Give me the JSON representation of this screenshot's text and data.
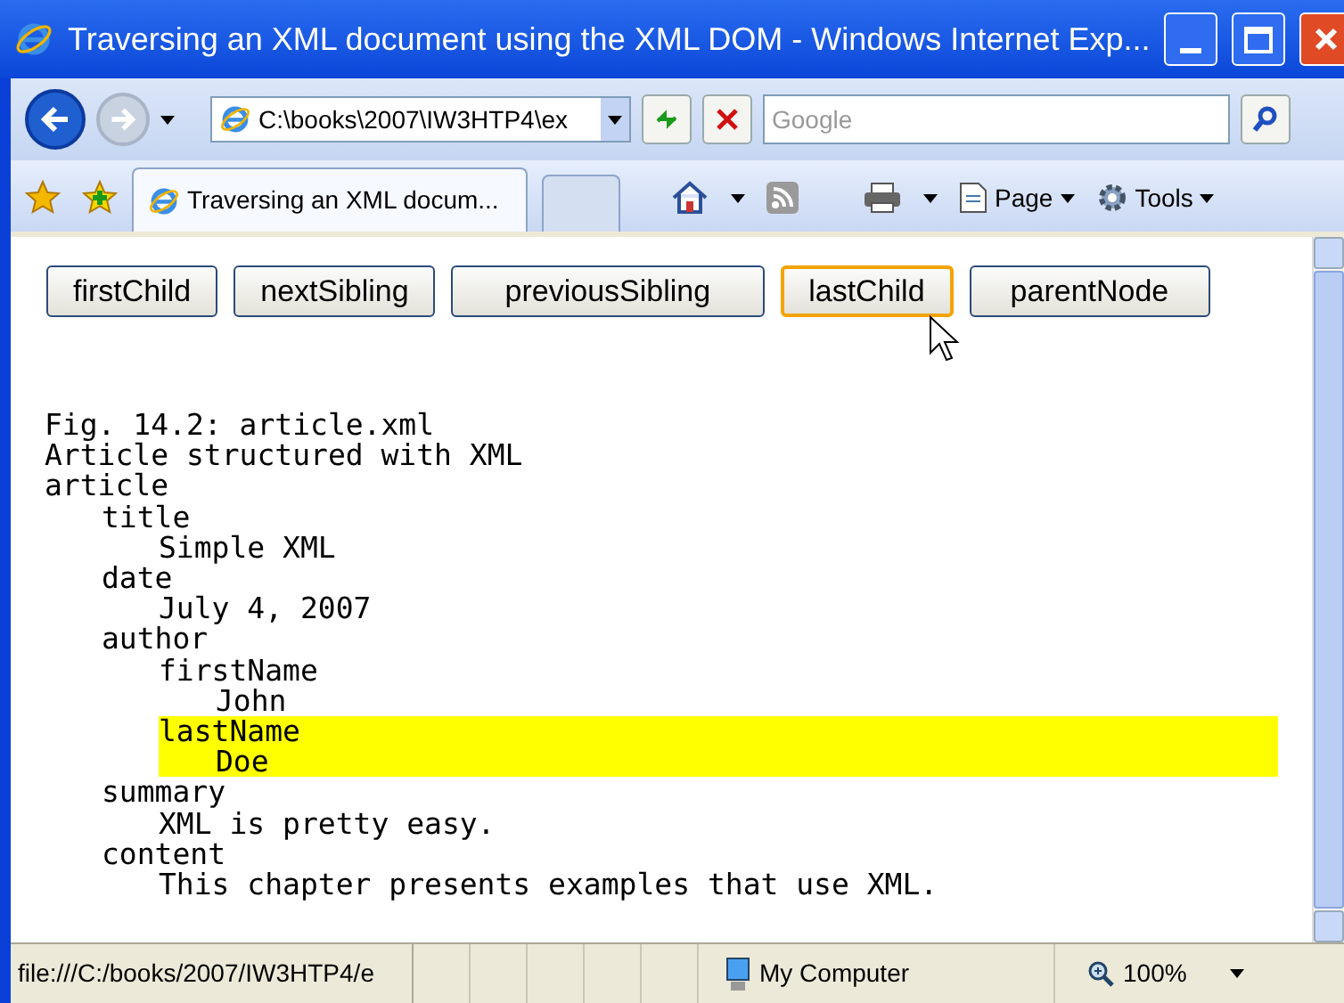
{
  "window": {
    "title": "Traversing an XML document using the XML DOM - Windows Internet Exp..."
  },
  "address_bar": {
    "value": "C:\\books\\2007\\IW3HTP4\\ex"
  },
  "search": {
    "placeholder": "Google"
  },
  "tabs": [
    {
      "label": "Traversing an XML docum...",
      "selected": true
    }
  ],
  "command_bar": [
    {
      "label": "Page",
      "kind": "menu"
    },
    {
      "label": "Tools",
      "kind": "menu"
    }
  ],
  "buttons": [
    {
      "label": "firstChild",
      "focused": false
    },
    {
      "label": "nextSibling",
      "focused": false
    },
    {
      "label": "previousSibling",
      "focused": false
    },
    {
      "label": "lastChild",
      "focused": true
    },
    {
      "label": "parentNode",
      "focused": false
    }
  ],
  "tree": [
    {
      "text": "Fig. 14.2: article.xml",
      "highlighted": false
    },
    {
      "text": "Article structured with XML",
      "highlighted": false
    },
    {
      "text": "article",
      "highlighted": false,
      "children": [
        {
          "text": "title",
          "highlighted": false,
          "children": [
            {
              "text": "Simple XML",
              "highlighted": false
            }
          ]
        },
        {
          "text": "date",
          "highlighted": false,
          "children": [
            {
              "text": "July 4, 2007",
              "highlighted": false
            }
          ]
        },
        {
          "text": "author",
          "highlighted": false,
          "children": [
            {
              "text": "firstName",
              "highlighted": false,
              "children": [
                {
                  "text": "John",
                  "highlighted": false
                }
              ]
            },
            {
              "text": "lastName",
              "highlighted": true,
              "children": [
                {
                  "text": "Doe",
                  "highlighted": true
                }
              ]
            }
          ]
        },
        {
          "text": "summary",
          "highlighted": false,
          "children": [
            {
              "text": "XML is pretty easy.",
              "highlighted": false
            }
          ]
        },
        {
          "text": "content",
          "highlighted": false,
          "children": [
            {
              "text": "This chapter presents examples that use XML.",
              "highlighted": false
            }
          ]
        }
      ]
    }
  ],
  "status_bar": {
    "url": "file:///C:/books/2007/IW3HTP4/e",
    "zone": "My Computer",
    "zoom": "100%"
  }
}
